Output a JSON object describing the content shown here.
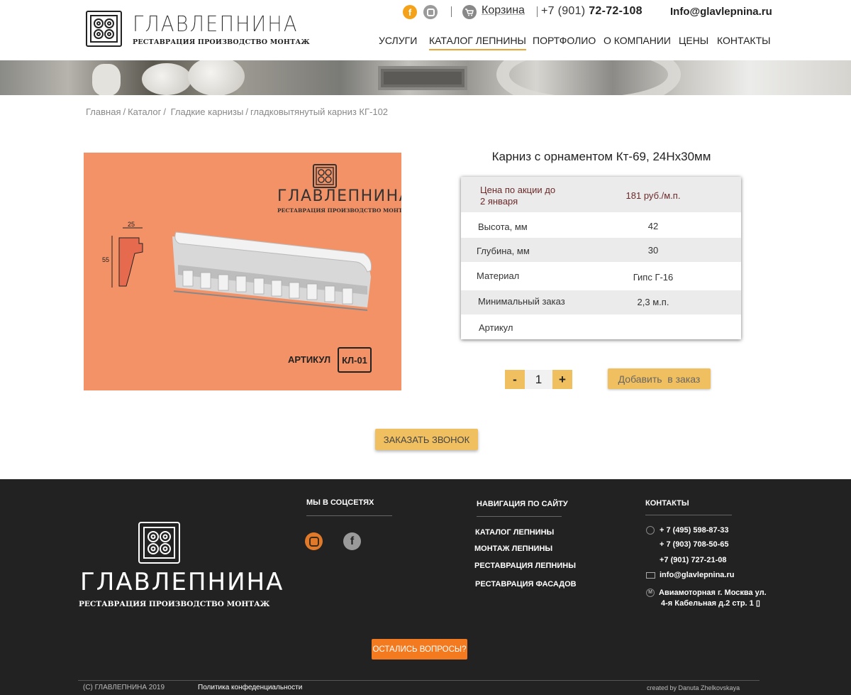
{
  "header": {
    "logo_name": "ГЛАВЛЕПНИНА",
    "logo_tagline": "РЕСТАВРАЦИЯ ПРОИЗВОДСТВО МОНТАЖ",
    "facebook_glyph": "f",
    "cart_label": "Корзина",
    "phone_prefix": "+7 (901)",
    "phone_main": "72-72-108",
    "email": "Info@glavlepnina.ru",
    "icons": [
      "facebook-icon",
      "instagram-icon",
      "cart-icon"
    ]
  },
  "nav": [
    {
      "label": "УСЛУГИ",
      "active": false
    },
    {
      "label": "КАТАЛОГ ЛЕПНИНЫ",
      "active": true
    },
    {
      "label": "ПОРТФОЛИО",
      "active": false
    },
    {
      "label": "О КОМПАНИИ",
      "active": false
    },
    {
      "label": "ЦЕНЫ",
      "active": false
    },
    {
      "label": "КОНТАКТЫ",
      "active": false
    }
  ],
  "breadcrumb": [
    "Главная",
    "Каталог",
    "Гладкие карнизы",
    "гладковытянутый карниз КГ-102"
  ],
  "product_image": {
    "brand": "ГЛАВЛЕПНИНА",
    "tagline": "РЕСТАВРАЦИЯ ПРОИЗВОДСТВО МОНТАЖ",
    "article_label": "АРТИКУЛ",
    "article_code": "КЛ-01",
    "dim_width": "25",
    "dim_height": "55",
    "background_color": "#f39267"
  },
  "product": {
    "title": "Карниз с орнаментом Кт-69, 24Hx30мм",
    "specs": [
      {
        "key_line1": "Цена по акции до",
        "key_line2": "2 января",
        "value": "181 руб./м.п."
      },
      {
        "key_line1": "Высота, мм",
        "key_line2": "",
        "value": "42"
      },
      {
        "key_line1": "Глубина, мм",
        "key_line2": "",
        "value": "30"
      },
      {
        "key_line1": "Материал",
        "key_line2": "",
        "value": "Гипс Г-16"
      },
      {
        "key_line1": "Минимальный заказ",
        "key_line2": "",
        "value": "2,3 м.п."
      },
      {
        "key_line1": "Артикул",
        "key_line2": "",
        "value": ""
      }
    ],
    "minus_label": "-",
    "quantity": "1",
    "plus_label": "+",
    "add_to_order": "Добавить  в заказ",
    "call_button": "ЗАКАЗАТЬ ЗВОНОК"
  },
  "footer": {
    "logo_name": "ГЛАВЛЕПНИНА",
    "logo_tagline": "РЕСТАВРАЦИЯ ПРОИЗВОДСТВО МОНТАЖ",
    "social_heading": "МЫ В СОЦСЕТЯХ",
    "facebook_glyph": "f",
    "nav_heading": "НАВИГАЦИЯ ПО САЙТУ",
    "nav_links": [
      "КАТАЛОГ ЛЕПНИНЫ",
      "МОНТАЖ ЛЕПНИНЫ",
      "РЕСТАВРАЦИЯ ЛЕПНИНЫ",
      "РЕСТАВРАЦИЯ ФАСАДОВ"
    ],
    "contacts_heading": "КОНТАКТЫ",
    "phones": [
      "+ 7 (495) 598-87-33",
      "+ 7 (903) 708-50-65",
      "+7 (901) 727-21-08"
    ],
    "email": "info@glavlepnina.ru",
    "metro_glyph": "М",
    "address_line1": "Авиамоторная г. Москва ул.",
    "address_line2": "4-я Кабельная д.2 стр. 1 ▯",
    "questions_button": "ОСТАЛИСЬ ВОПРОСЫ?",
    "copyright": "(C) ГЛАВЛЕПНИНА 2019",
    "privacy": "Политика конфеденциальности",
    "credit": "created by Danuta Zhelkovskaya"
  },
  "colors": {
    "accent": "#f0bf60",
    "footer_bg": "#222222",
    "questions_button": "#f47a20",
    "nav_underline": "#e8a536"
  }
}
